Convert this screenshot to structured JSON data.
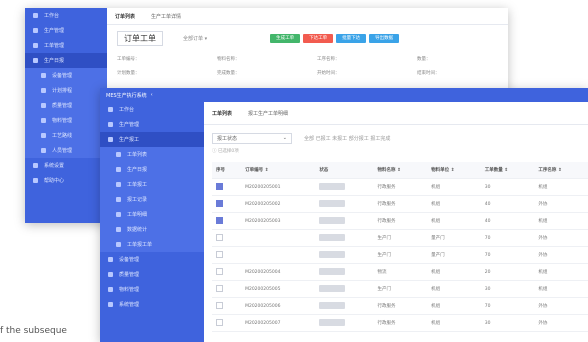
{
  "back": {
    "menu": [
      "工作台",
      "生产管理",
      "工单管理",
      "生产日报",
      "设备管理",
      "计划排程",
      "质量管理",
      "物料管理",
      "工艺路线",
      "人员管理",
      "系统设置",
      "帮助中心"
    ],
    "tabs": [
      "订单列表",
      "生产工单详情"
    ],
    "header_title": "订单工单",
    "select_value": "全部订单",
    "buttons": [
      {
        "label": "生成工单",
        "color": "#43b66b"
      },
      {
        "label": "下达工单",
        "color": "#f25b4f"
      },
      {
        "label": "批量下达",
        "color": "#3aa3e8"
      },
      {
        "label": "导出数据",
        "color": "#3aa3e8"
      }
    ],
    "fields": [
      "工单编号：",
      "物料名称：",
      "工序名称：",
      "数量：",
      "计划数量：",
      "完成数量：",
      "开始时间：",
      "结束时间："
    ]
  },
  "front": {
    "app_title": "MES生产执行系统",
    "menu": [
      "工作台",
      "生产管理",
      "生产报工",
      "工单列表",
      "生产日报",
      "工单报工",
      "报工记录",
      "工单明细",
      "数据统计",
      "工单报工单",
      "设备管理",
      "质量管理",
      "物料管理",
      "系统管理"
    ],
    "tabs": [
      "工单列表",
      "报工生产工单明细"
    ],
    "filter_label": "报工状态",
    "filter_options": "全部 已报工 未报工 部分报工 报工完成",
    "selected_info": "已选择0项",
    "columns": [
      "序号",
      "订单编号",
      "状态",
      "物料名称",
      "物料单位",
      "工单数量",
      "工序名称"
    ],
    "rows": [
      [
        "",
        "M20200205001",
        "",
        "行政服务",
        "机组",
        "30",
        "机组"
      ],
      [
        "",
        "M20200205002",
        "",
        "行政服务",
        "机组",
        "40",
        "外协"
      ],
      [
        "",
        "M20200205003",
        "",
        "行政服务",
        "机组",
        "40",
        "机组"
      ],
      [
        "",
        "",
        "",
        "生产门",
        "量产门",
        "70",
        "外协"
      ],
      [
        "",
        "",
        "",
        "生产门",
        "量产门",
        "70",
        "外协"
      ],
      [
        "",
        "M20200205004",
        "",
        "物流",
        "机组",
        "20",
        "机组"
      ],
      [
        "",
        "M20200205005",
        "",
        "生产门",
        "机组",
        "30",
        "机组"
      ],
      [
        "",
        "M20200205006",
        "",
        "行政服务",
        "机组",
        "70",
        "外协"
      ],
      [
        "",
        "M20200205007",
        "",
        "行政服务",
        "机组",
        "30",
        "外协"
      ]
    ],
    "row_checked": [
      true,
      true,
      true,
      false,
      false,
      false,
      false,
      false,
      false
    ]
  },
  "side_text": "f the subseque"
}
